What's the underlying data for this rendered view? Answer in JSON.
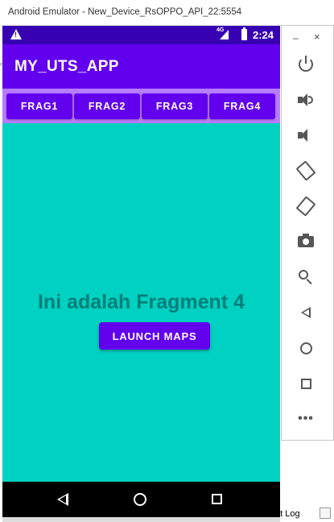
{
  "window": {
    "title": "Android Emulator - New_Device_RsOPPO_API_22:5554"
  },
  "status_bar": {
    "signal_label": "4G",
    "time": "2:24"
  },
  "app_bar": {
    "title": "MY_UTS_APP"
  },
  "tabs": [
    {
      "label": "FRAG1"
    },
    {
      "label": "FRAG2"
    },
    {
      "label": "FRAG3"
    },
    {
      "label": "FRAG4"
    }
  ],
  "content": {
    "message": "Ini adalah Fragment 4",
    "launch_button": "LAUNCH MAPS"
  },
  "toolbar": {
    "minimize": "–",
    "close": "×",
    "more": "•••"
  },
  "ide_panel": {
    "tab_fragment": "nt Log"
  },
  "colors": {
    "status_bar": "#3700b3",
    "primary": "#6200ee",
    "tab_strip": "#b77cff",
    "background": "#00d1c1",
    "message_text": "#007f7a"
  }
}
